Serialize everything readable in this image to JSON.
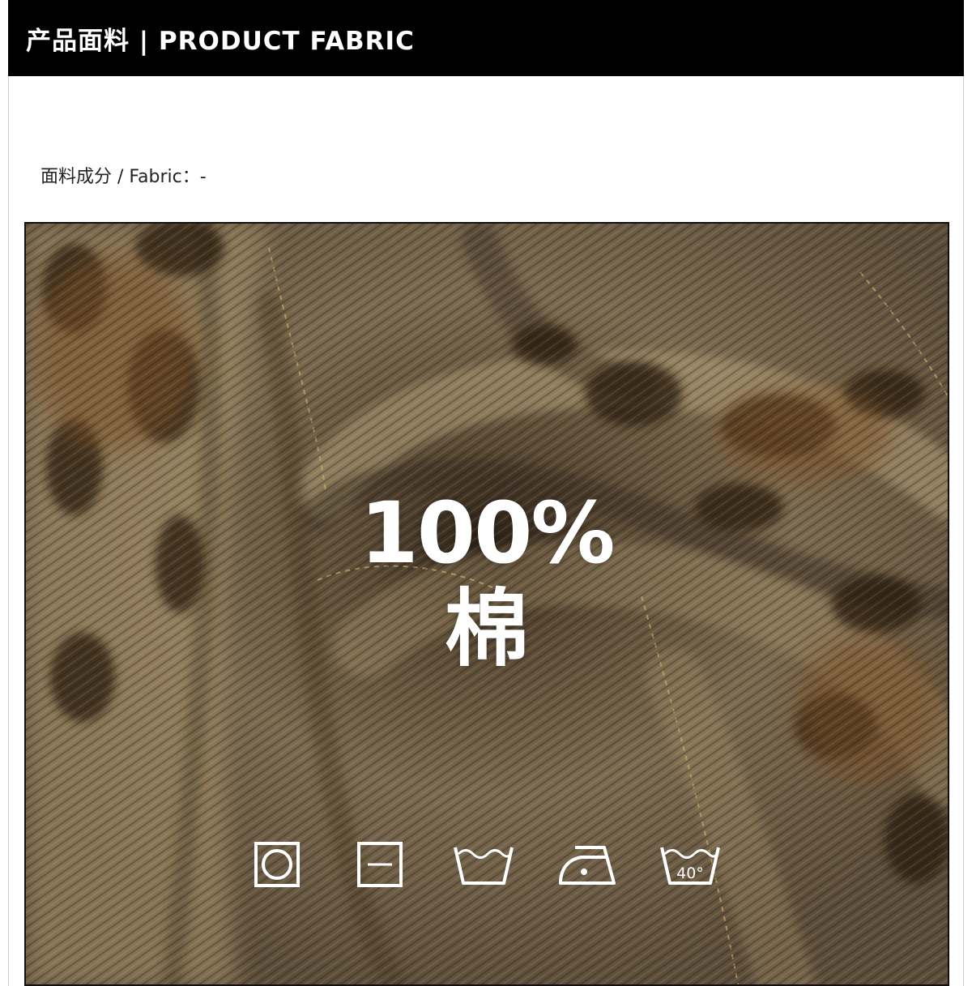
{
  "header": {
    "title": "产品面料 | PRODUCT FABRIC"
  },
  "fabric": {
    "label": "面料成分 / Fabric：-"
  },
  "composition": {
    "percent": "100%",
    "material": "棉"
  },
  "care_icons": [
    {
      "name": "tumble-dry-icon"
    },
    {
      "name": "dry-flat-icon"
    },
    {
      "name": "hand-wash-icon"
    },
    {
      "name": "iron-low-icon"
    },
    {
      "name": "wash-40-icon",
      "label": "40°"
    }
  ],
  "colors": {
    "header_bg": "#000000",
    "header_text": "#ffffff",
    "fabric_base": "#6e5e48",
    "overlay_text": "#ffffff"
  }
}
